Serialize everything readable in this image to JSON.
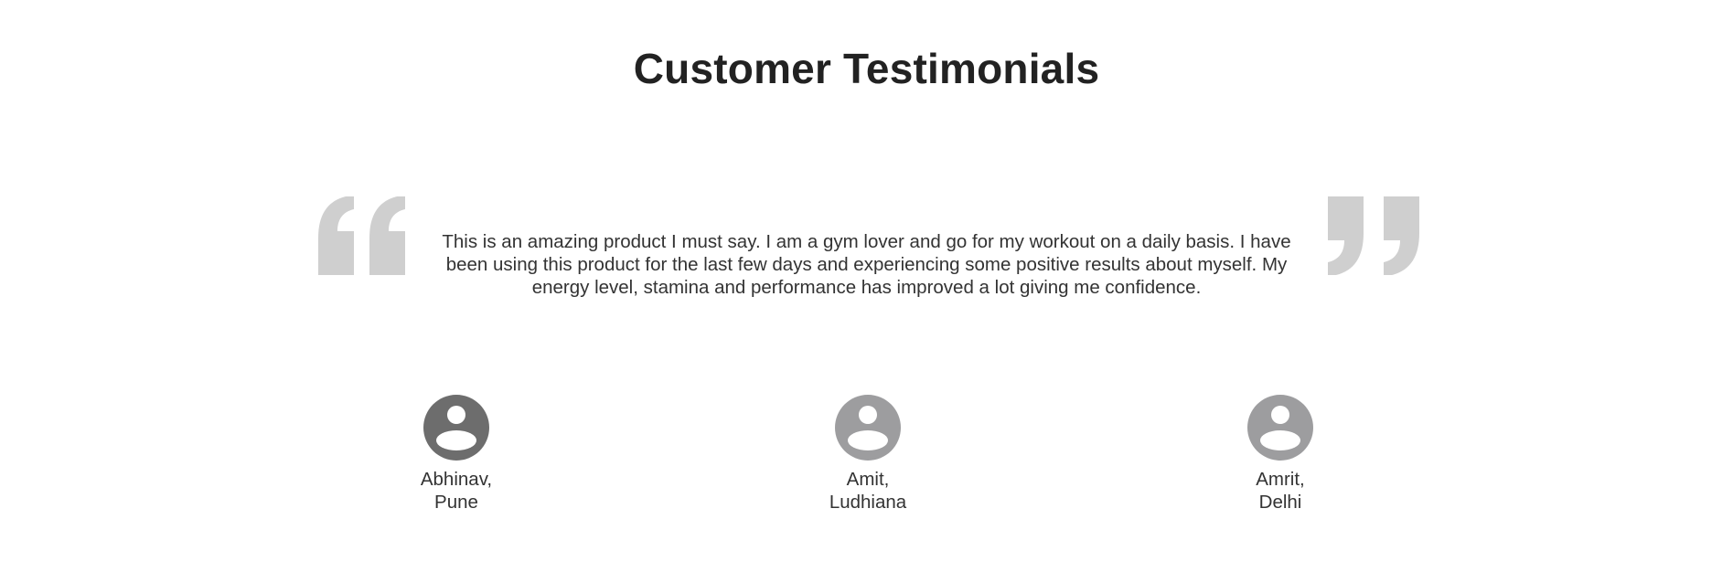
{
  "header": {
    "title": "Customer Testimonials"
  },
  "testimonial": {
    "text": "This is an amazing product I must say. I am a gym lover and go for my workout on a daily basis. I have been using this product for the last few days and experiencing some positive results about myself. My energy level, stamina and performance has improved a lot giving me confidence.",
    "quote_color": "#cfcfcf"
  },
  "customers": [
    {
      "name": "Abhinav,",
      "city": "Pune",
      "avatar_color": "#6d6d6d",
      "active": true
    },
    {
      "name": "Amit,",
      "city": "Ludhiana",
      "avatar_color": "#9d9d9f",
      "active": false
    },
    {
      "name": "Amrit,",
      "city": "Delhi",
      "avatar_color": "#9d9d9f",
      "active": false
    }
  ]
}
